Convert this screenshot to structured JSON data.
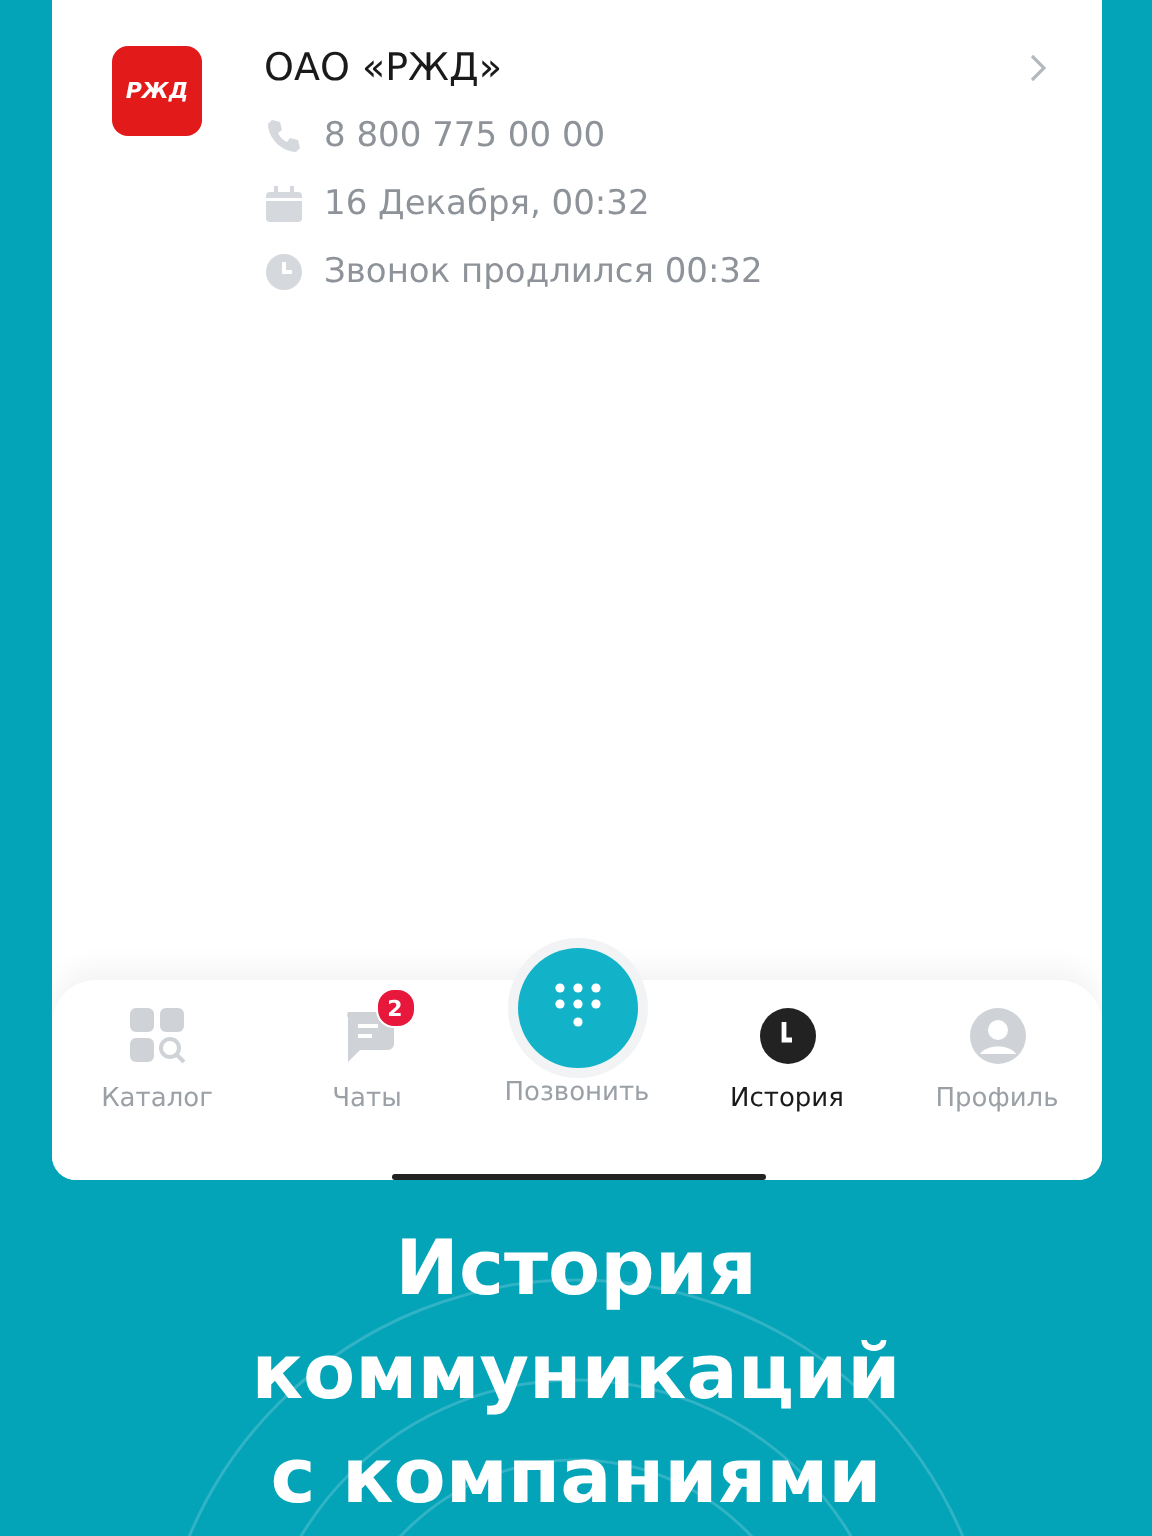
{
  "call": {
    "logo_text": "РЖД",
    "company": "ОАО «РЖД»",
    "details": [
      {
        "kind": "phone",
        "text": "8 800 775 00 00"
      },
      {
        "kind": "date",
        "text": "16 Декабря, 00:32"
      },
      {
        "kind": "duration",
        "text": "Звонок продлился 00:32"
      }
    ]
  },
  "tabs": [
    {
      "kind": "catalog",
      "label": "Каталог",
      "selected": false
    },
    {
      "kind": "chats",
      "label": "Чаты",
      "selected": false,
      "badge": "2"
    },
    {
      "kind": "call",
      "label": "Позвонить",
      "selected": false
    },
    {
      "kind": "history",
      "label": "История",
      "selected": true
    },
    {
      "kind": "profile",
      "label": "Профиль",
      "selected": false
    }
  ],
  "caption": [
    "История",
    "коммуникаций",
    "с компаниями"
  ]
}
